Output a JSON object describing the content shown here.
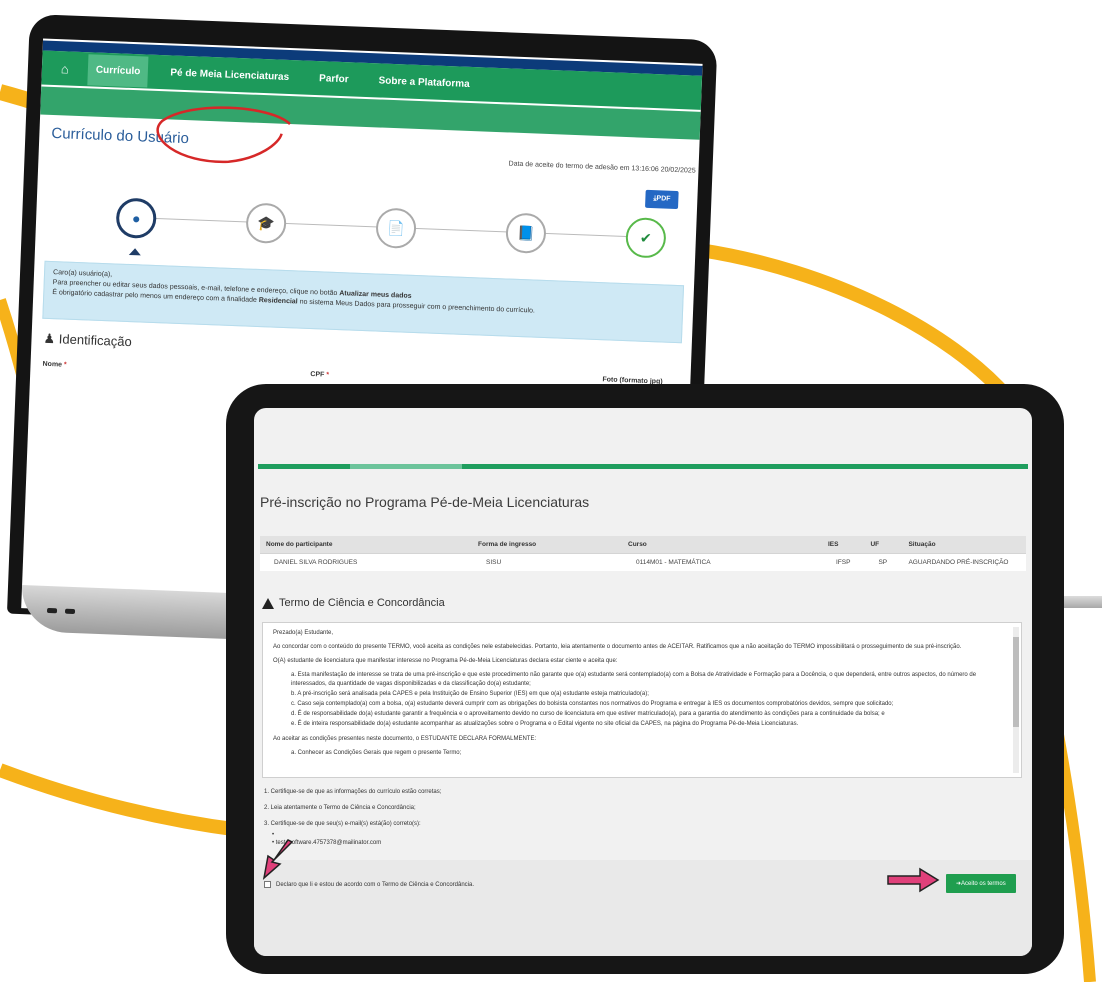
{
  "laptop": {
    "nav": {
      "items": [
        "Currículo",
        "Pé de Meia Licenciaturas",
        "Parfor",
        "Sobre a Plataforma"
      ]
    },
    "page_title": "Currículo do Usuário",
    "acceptance_date": "Data de aceite do termo de adesão em 13:16:06 20/02/2025",
    "pdf_label": "PDF",
    "info": {
      "line1": "Caro(a) usuário(a),",
      "line2_pre": "Para preencher ou editar seus dados pessoais, e-mail, telefone e endereço, clique no botão ",
      "line2_bold": "Atualizar meus dados",
      "line3_pre": "É obrigatório cadastrar pelo menos um endereço com a finalidade ",
      "line3_bold": "Residencial",
      "line3_post": " no sistema Meus Dados para prosseguir com o preenchimento do currículo."
    },
    "section_title": "Identificação",
    "fields": {
      "nome": "Nome",
      "cpf": "CPF",
      "foto": "Foto (formato jpg)",
      "required_mark": "*"
    }
  },
  "tablet": {
    "title": "Pré-inscrição no Programa Pé-de-Meia Licenciaturas",
    "table": {
      "headers": [
        "Nome do participante",
        "Forma de ingresso",
        "Curso",
        "IES",
        "UF",
        "Situação"
      ],
      "row": [
        "DANIEL SILVA RODRIGUES",
        "SISU",
        "0114M01 - MATEMÁTICA",
        "IFSP",
        "SP",
        "AGUARDANDO PRÉ-INSCRIÇÃO"
      ]
    },
    "terms_title": "Termo de Ciência e Concordância",
    "terms": {
      "greeting": "Prezado(a) Estudante,",
      "intro": "Ao concordar com o conteúdo do presente TERMO, você aceita as condições nele estabelecidas. Portanto, leia atentamente o documento antes de ACEITAR. Ratificamos que a não aceitação do TERMO impossibilitará o prosseguimento de sua pré-inscrição.",
      "declares": "O(A) estudante de licenciatura que manifestar interesse no Programa Pé-de-Meia Licenciaturas declara estar ciente e aceita que:",
      "items": [
        "a. Esta manifestação de interesse se trata de uma pré-inscrição e que este procedimento não garante que o(a) estudante será contemplado(a) com a Bolsa de Atratividade e Formação para a Docência, o que dependerá, entre outros aspectos, do número de interessados, da quantidade de vagas disponibilizadas e da classificação do(a) estudante;",
        "b. A pré-inscrição será analisada pela CAPES e pela Instituição de Ensino Superior (IES) em que o(a) estudante esteja matriculado(a);",
        "c. Caso seja contemplado(a) com a bolsa, o(a) estudante deverá cumprir com as obrigações do bolsista constantes nos normativos do Programa e entregar à IES os documentos comprobatórios devidos, sempre que solicitado;",
        "d. É de responsabilidade do(a) estudante garantir a frequência e o aproveitamento devido no curso de licenciatura em que estiver matriculado(a), para a garantia do atendimento às condições para a continuidade da bolsa; e",
        "e. É de inteira responsabilidade do(a) estudante acompanhar as atualizações sobre o Programa e o Edital vigente no site oficial da CAPES, na página do Programa Pé-de-Meia Licenciaturas."
      ],
      "formally": "Ao aceitar as condições presentes neste documento, o ESTUDANTE DECLARA FORMALMENTE:",
      "formal_items": [
        "a. Conhecer as Condições Gerais que regem o presente Termo;"
      ]
    },
    "steps": [
      "1. Certifique-se de que as informações do currículo estão corretas;",
      "2. Leia atentamente o Termo de Ciência e Concordância;",
      "3. Certifique-se de que seu(s) e-mail(s) está(ão) correto(s):"
    ],
    "bullet_empty": "•",
    "email": "• testesoftware.4757378@mailinator.com",
    "checkbox_label": "Declaro que li e estou de acordo com o Termo de Ciência e Concordância.",
    "accept_label": "➜Aceito os termos"
  },
  "colors": {
    "brand_green": "#1d9a5b",
    "accent_yellow": "#f6b21a",
    "annotation_red": "#d62828",
    "annotation_pink": "#e0407a",
    "info_blue": "#cfe9f5"
  }
}
